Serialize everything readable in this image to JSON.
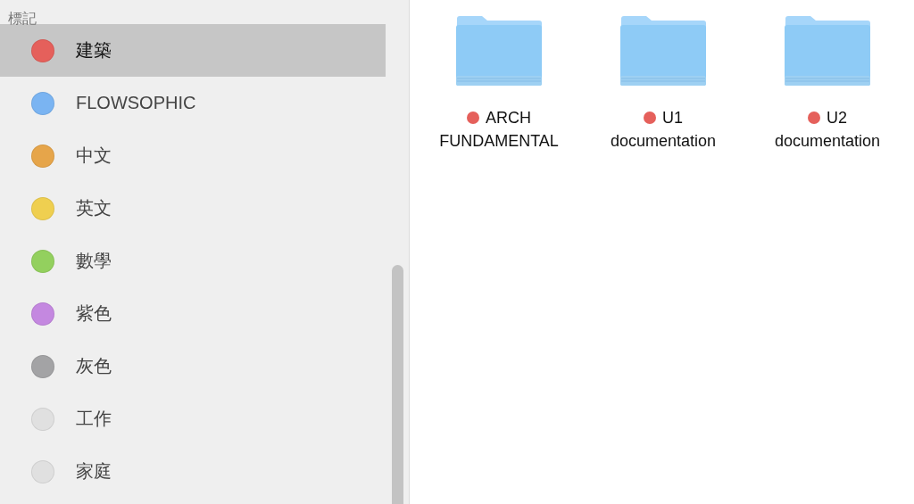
{
  "sidebar": {
    "heading": "標記",
    "tags": [
      {
        "label": "建築",
        "color": "#e5605b",
        "selected": true
      },
      {
        "label": "FLOWSOPHIC",
        "color": "#7ab4f2",
        "selected": false
      },
      {
        "label": "中文",
        "color": "#e6a54a",
        "selected": false
      },
      {
        "label": "英文",
        "color": "#efcf50",
        "selected": false
      },
      {
        "label": "數學",
        "color": "#93d05e",
        "selected": false
      },
      {
        "label": "紫色",
        "color": "#c488e0",
        "selected": false
      },
      {
        "label": "灰色",
        "color": "#a3a3a5",
        "selected": false
      },
      {
        "label": "工作",
        "color": "#e0e0e0",
        "selected": false
      },
      {
        "label": "家庭",
        "color": "#e0e0e0",
        "selected": false
      }
    ]
  },
  "folders": [
    {
      "lines": [
        "ARCH",
        "FUNDAMENTAL"
      ],
      "color": "#e5605b"
    },
    {
      "lines": [
        "U1",
        "documentation"
      ],
      "color": "#e5605b"
    },
    {
      "lines": [
        "U2",
        "documentation"
      ],
      "color": "#e5605b"
    }
  ]
}
